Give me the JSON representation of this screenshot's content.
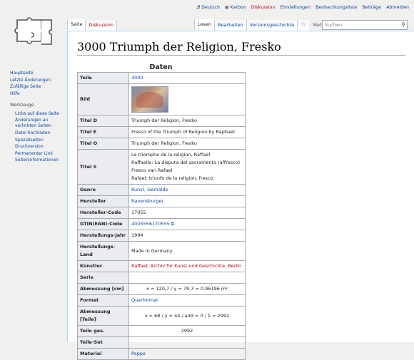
{
  "personal": {
    "lang": "Deutsch",
    "user": "Karbon",
    "talk": "Diskussion",
    "prefs": "Einstellungen",
    "watchlist": "Beobachtungsliste",
    "contribs": "Beiträge",
    "logout": "Abmelden"
  },
  "tabs": {
    "page": "Seite",
    "discussion": "Diskussion",
    "read": "Lesen",
    "edit": "Bearbeiten",
    "history": "Versionsgeschichte",
    "more": "Mehr",
    "watch_icon": "star-icon"
  },
  "search": {
    "placeholder": "Suchen"
  },
  "sidebar": {
    "main": [
      "Hauptseite",
      "Letzte Änderungen",
      "Zufällige Seite",
      "Hilfe"
    ],
    "tools_title": "Werkzeuge",
    "tools": [
      "Links auf diese Seite",
      "Änderungen an verlinkten Seiten",
      "Datei hochladen",
      "Spezialseiten",
      "Druckversion",
      "Permanenter Link",
      "Seiteninformationen"
    ]
  },
  "page": {
    "title": "3000 Triumph der Religion, Fresko",
    "table_title": "Daten"
  },
  "rows": {
    "teile": {
      "k": "Teile",
      "v": "3000"
    },
    "bild": {
      "k": "Bild"
    },
    "titel_d": {
      "k": "Titel D",
      "v": "Triumph der Religion, Fresko"
    },
    "titel_e": {
      "k": "Titel E",
      "v": "Fresco of the Triumph of Religion by Raphael"
    },
    "titel_o": {
      "k": "Titel O",
      "v": "Triumph der Religion, Fresko"
    },
    "titel_s": {
      "k": "Titel S",
      "v": [
        "Le triomphe de la religion, Raffael",
        "Raffaello: La disputa del sacramento (affresco)",
        "Fresco van Rafael",
        "Rafael: triunfo de la religion, fresco"
      ]
    },
    "genre": {
      "k": "Genre",
      "v": "Kunst, Gemälde"
    },
    "hersteller": {
      "k": "Hersteller",
      "v": "Ravensburger"
    },
    "hersteller_code": {
      "k": "Hersteller-Code",
      "v": "17055"
    },
    "gtin": {
      "k": "GTIN(EAN)-Code",
      "v": "4005556170555"
    },
    "jahr": {
      "k": "Herstellungs-Jahr",
      "v": "1994"
    },
    "land": {
      "k": "Herstellungs-Land",
      "v": "Made in Germany"
    },
    "kuenstler": {
      "k": "Künstler",
      "v": "Raffael, Archiv für Kunst und Geschichte, Berlin"
    },
    "serie": {
      "k": "Serie",
      "v": ""
    },
    "abm_cm": {
      "k": "Abmessung [cm]",
      "v": "x = 120,7  /  y = 79,7   = 0.96196 m²"
    },
    "format": {
      "k": "Format",
      "v": "Querformat"
    },
    "abm_teile": {
      "k": "Abmessung [Teile]",
      "v": "x = 68  /  y = 44  /  add = 0  /  Σ = 2992"
    },
    "teile_ges": {
      "k": "Teile ges.",
      "v": "2992"
    },
    "teile_set": {
      "k": "Teile-Set",
      "v": ""
    },
    "material": {
      "k": "Material",
      "v": "Pappe"
    }
  },
  "colors": {
    "link": "#0645ad",
    "redlink": "#ba0000",
    "border": "#a2a9b1",
    "header_cell": "#eaecf0"
  }
}
